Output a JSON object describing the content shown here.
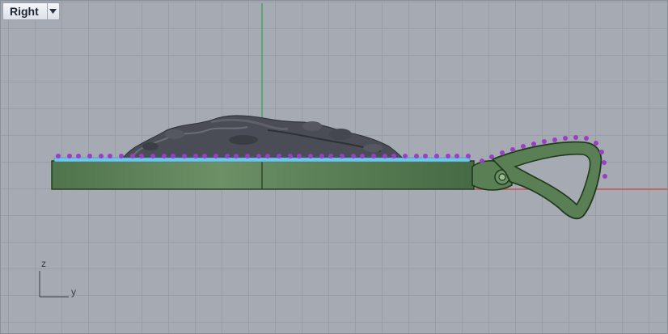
{
  "viewport": {
    "name": "Right",
    "menu_icon": "chevron-down-icon"
  },
  "axes": {
    "vertical_label": "z",
    "horizontal_label": "y"
  },
  "colors": {
    "grid_background": "#a6abb3",
    "grid_line": "#969ba2",
    "world_axis_green": "#2fa04a",
    "world_axis_red": "#c8453e",
    "model_green": "#5a7f55",
    "model_outline": "#1f3a1c",
    "highlight_blue": "#6ec6ea",
    "highlight_purple": "#9a3fc2",
    "relief_dark": "#4a4d55"
  }
}
